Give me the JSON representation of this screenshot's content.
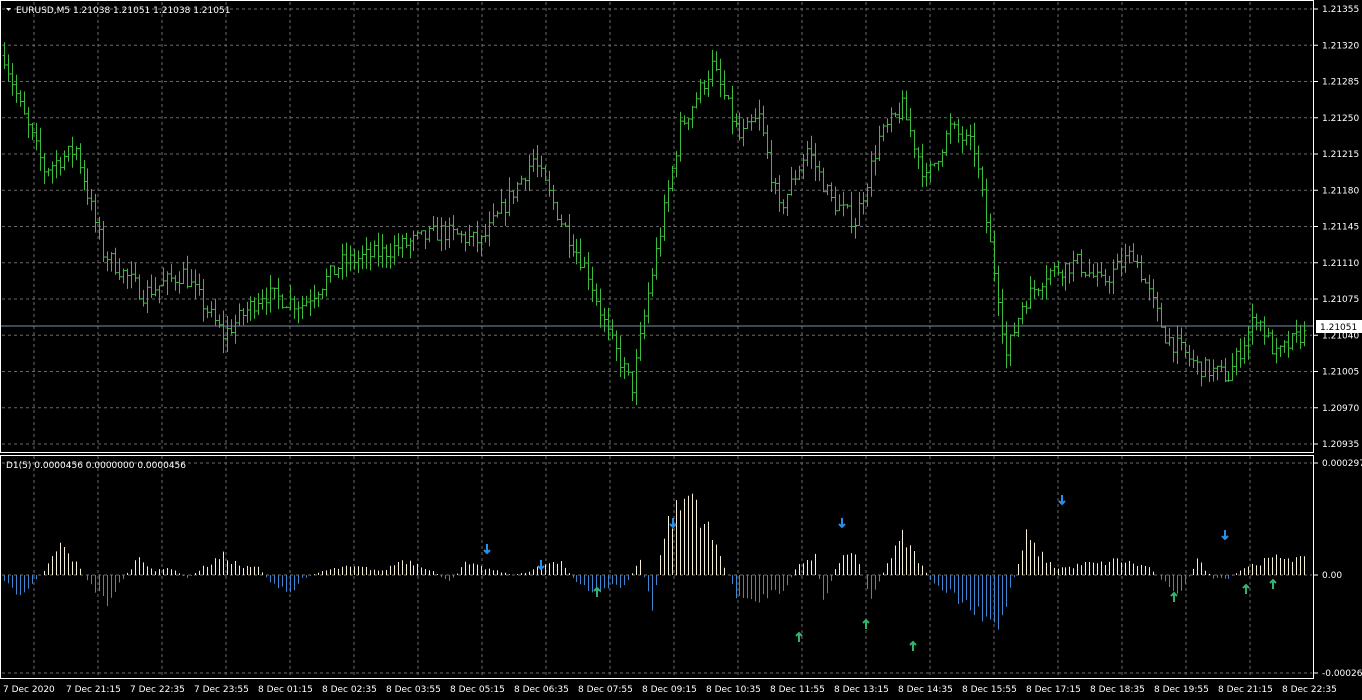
{
  "window": {
    "symbol_header": "EURUSD,M5  1.21038 1.21051 1.21038 1.21051",
    "current_price": "1.21051"
  },
  "colors": {
    "background": "#000000",
    "grid": "#6a6a6a",
    "bars": "#3dbb3d",
    "price_line": "#7b8fa3",
    "hist_positive": "#f5eed7",
    "hist_negative": "#3f86d1",
    "arrow_sell": "#2b8fe6",
    "arrow_buy": "#33b36b",
    "text": "#ffffff"
  },
  "price_axis": {
    "labels": [
      "1.21355",
      "1.21320",
      "1.21285",
      "1.21250",
      "1.21215",
      "1.21180",
      "1.21145",
      "1.21110",
      "1.21075",
      "1.21040",
      "1.21005",
      "1.20970",
      "1.20935"
    ]
  },
  "indicator": {
    "header": "D1(5) 0.0000456 0.0000000 0.0000456",
    "axis_labels": [
      "0.0002972",
      "0.00",
      "-0.000261"
    ]
  },
  "time_axis": {
    "labels": [
      "7 Dec 2020",
      "7 Dec 21:15",
      "7 Dec 22:35",
      "7 Dec 23:55",
      "8 Dec 01:15",
      "8 Dec 02:35",
      "8 Dec 03:55",
      "8 Dec 05:15",
      "8 Dec 06:35",
      "8 Dec 07:55",
      "8 Dec 09:15",
      "8 Dec 10:35",
      "8 Dec 11:55",
      "8 Dec 13:15",
      "8 Dec 14:35",
      "8 Dec 15:55",
      "8 Dec 17:15",
      "8 Dec 18:35",
      "8 Dec 19:55",
      "8 Dec 21:15",
      "8 Dec 22:35"
    ]
  },
  "chart_data": [
    {
      "type": "ohlc",
      "title": "EURUSD,M5",
      "ylim": [
        1.2093,
        1.2137
      ],
      "anchor_closes": [
        [
          0,
          1.2131
        ],
        [
          4,
          1.2126
        ],
        [
          10,
          1.212
        ],
        [
          18,
          1.2122
        ],
        [
          25,
          1.2112
        ],
        [
          35,
          1.2108
        ],
        [
          45,
          1.211
        ],
        [
          55,
          1.2104
        ],
        [
          65,
          1.2108
        ],
        [
          75,
          1.2107
        ],
        [
          85,
          1.2111
        ],
        [
          95,
          1.2112
        ],
        [
          110,
          1.2114
        ],
        [
          120,
          1.2113
        ],
        [
          125,
          1.2116
        ],
        [
          133,
          1.2121
        ],
        [
          140,
          1.2115
        ],
        [
          147,
          1.211
        ],
        [
          152,
          1.2104
        ],
        [
          158,
          1.2099
        ],
        [
          162,
          1.2108
        ],
        [
          170,
          1.2124
        ],
        [
          178,
          1.213
        ],
        [
          185,
          1.2123
        ],
        [
          190,
          1.2125
        ],
        [
          195,
          1.2116
        ],
        [
          202,
          1.2122
        ],
        [
          208,
          1.2117
        ],
        [
          214,
          1.2115
        ],
        [
          220,
          1.2123
        ],
        [
          226,
          1.2126
        ],
        [
          232,
          1.2119
        ],
        [
          238,
          1.2124
        ],
        [
          244,
          1.2122
        ],
        [
          250,
          1.2108
        ],
        [
          252,
          1.2102
        ],
        [
          256,
          1.2107
        ],
        [
          262,
          1.211
        ],
        [
          270,
          1.2111
        ],
        [
          276,
          1.2109
        ],
        [
          284,
          1.2112
        ],
        [
          288,
          1.2108
        ],
        [
          292,
          1.2104
        ],
        [
          300,
          1.2101
        ],
        [
          308,
          1.21
        ],
        [
          315,
          1.2106
        ],
        [
          320,
          1.2102
        ],
        [
          326,
          1.2104
        ]
      ]
    },
    {
      "type": "bar",
      "title": "D1(5)",
      "ylim": [
        -0.000261,
        0.0002972
      ],
      "anchors": [
        [
          0,
          -2e-05
        ],
        [
          4,
          -5e-05
        ],
        [
          10,
          1e-05
        ],
        [
          14,
          8e-05
        ],
        [
          18,
          3e-05
        ],
        [
          22,
          -3e-05
        ],
        [
          26,
          -7e-05
        ],
        [
          30,
          -1e-05
        ],
        [
          34,
          5e-05
        ],
        [
          38,
          1e-05
        ],
        [
          42,
          2e-05
        ],
        [
          46,
          -1e-05
        ],
        [
          50,
          2e-05
        ],
        [
          55,
          5e-05
        ],
        [
          60,
          2e-05
        ],
        [
          64,
          2e-05
        ],
        [
          68,
          -3e-05
        ],
        [
          72,
          -5e-05
        ],
        [
          75,
          -1e-05
        ],
        [
          80,
          1e-05
        ],
        [
          85,
          2e-05
        ],
        [
          90,
          2e-05
        ],
        [
          95,
          1e-05
        ],
        [
          100,
          4e-05
        ],
        [
          104,
          3e-05
        ],
        [
          108,
          1e-05
        ],
        [
          112,
          -2e-05
        ],
        [
          116,
          3e-05
        ],
        [
          120,
          2e-05
        ],
        [
          124,
          1e-05
        ],
        [
          128,
          0.0
        ],
        [
          132,
          1e-05
        ],
        [
          136,
          3e-05
        ],
        [
          140,
          3e-05
        ],
        [
          144,
          -2e-05
        ],
        [
          148,
          -5e-05
        ],
        [
          152,
          -3e-05
        ],
        [
          156,
          -3e-05
        ],
        [
          160,
          4e-05
        ],
        [
          163,
          -0.0001
        ],
        [
          166,
          0.00012
        ],
        [
          170,
          0.00018
        ],
        [
          173,
          0.00022
        ],
        [
          176,
          0.00014
        ],
        [
          180,
          5e-05
        ],
        [
          184,
          -5e-05
        ],
        [
          188,
          -8e-05
        ],
        [
          192,
          -5e-05
        ],
        [
          196,
          -4e-05
        ],
        [
          200,
          3e-05
        ],
        [
          204,
          5e-05
        ],
        [
          206,
          -7e-05
        ],
        [
          210,
          4e-05
        ],
        [
          214,
          6e-05
        ],
        [
          218,
          -6e-05
        ],
        [
          222,
          3e-05
        ],
        [
          226,
          0.0001
        ],
        [
          230,
          4e-05
        ],
        [
          234,
          -3e-05
        ],
        [
          238,
          -5e-05
        ],
        [
          242,
          -8e-05
        ],
        [
          246,
          -0.00012
        ],
        [
          250,
          -0.00014
        ],
        [
          253,
          -4e-05
        ],
        [
          257,
          0.0001
        ],
        [
          260,
          6e-05
        ],
        [
          264,
          2e-05
        ],
        [
          268,
          2e-05
        ],
        [
          272,
          3e-05
        ],
        [
          276,
          3e-05
        ],
        [
          280,
          4e-05
        ],
        [
          284,
          3e-05
        ],
        [
          288,
          2e-05
        ],
        [
          292,
          -2e-05
        ],
        [
          296,
          -5e-05
        ],
        [
          300,
          4e-05
        ],
        [
          304,
          -1e-05
        ],
        [
          308,
          -1e-05
        ],
        [
          312,
          2e-05
        ],
        [
          318,
          4e-05
        ],
        [
          322,
          5e-05
        ],
        [
          326,
          4e-05
        ]
      ],
      "sell_arrows": [
        [
          487,
          549
        ],
        [
          541,
          565
        ],
        [
          673,
          523
        ],
        [
          842,
          523
        ],
        [
          1062,
          500
        ],
        [
          1225,
          535
        ]
      ],
      "buy_arrows": [
        [
          597,
          592
        ],
        [
          799,
          637
        ],
        [
          866,
          624
        ],
        [
          913,
          646
        ],
        [
          1174,
          597
        ],
        [
          1246,
          589
        ],
        [
          1273,
          584
        ]
      ]
    }
  ]
}
